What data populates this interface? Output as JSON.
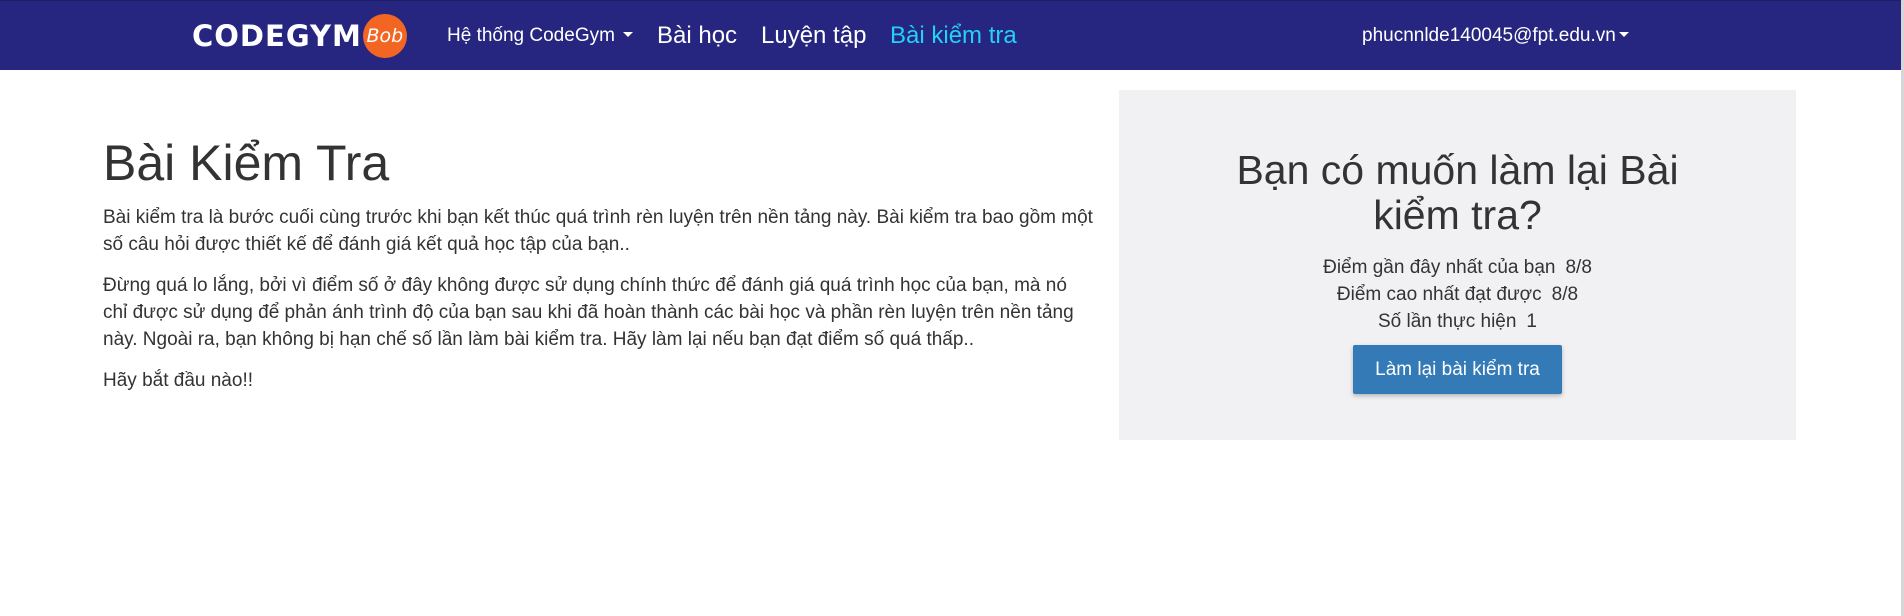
{
  "navbar": {
    "logo_text": "CODEGYM",
    "logo_badge": "Bob",
    "dropdown_label": "Hệ thống CodeGym",
    "lessons_label": "Bài học",
    "practice_label": "Luyện tập",
    "tests_label": "Bài kiểm tra",
    "user_email": "phucnnlde140045@fpt.edu.vn"
  },
  "colors": {
    "navbar_bg": "#262680",
    "active_nav": "#23d2f2",
    "logo_badge": "#f26522",
    "primary_button": "#337ab7",
    "panel_bg": "#f1f1f4"
  },
  "main": {
    "title": "Bài Kiểm Tra",
    "paragraphs": [
      "Bài kiểm tra là bước cuối cùng trước khi bạn kết thúc quá trình rèn luyện trên nền tảng này. Bài kiểm tra bao gồm một số câu hỏi được thiết kế để đánh giá kết quả học tập của bạn..",
      "Đừng quá lo lắng, bởi vì điểm số ở đây không được sử dụng chính thức để đánh giá quá trình học của bạn, mà nó chỉ được sử dụng để phản ánh trình độ của bạn sau khi đã hoàn thành các bài học và phần rèn luyện trên nền tảng này. Ngoài ra, bạn không bị hạn chế số lần làm bài kiểm tra. Hãy làm lại nếu bạn đạt điểm số quá thấp..",
      "Hãy bắt đầu nào!!"
    ]
  },
  "panel": {
    "title": "Bạn có muốn làm lại Bài kiểm tra?",
    "stats": [
      {
        "label": "Điểm gần đây nhất của bạn",
        "value": "8/8"
      },
      {
        "label": "Điểm cao nhất đạt được",
        "value": "8/8"
      },
      {
        "label": "Số lần thực hiện",
        "value": "1"
      }
    ],
    "retake_button": "Làm lại bài kiểm tra"
  }
}
